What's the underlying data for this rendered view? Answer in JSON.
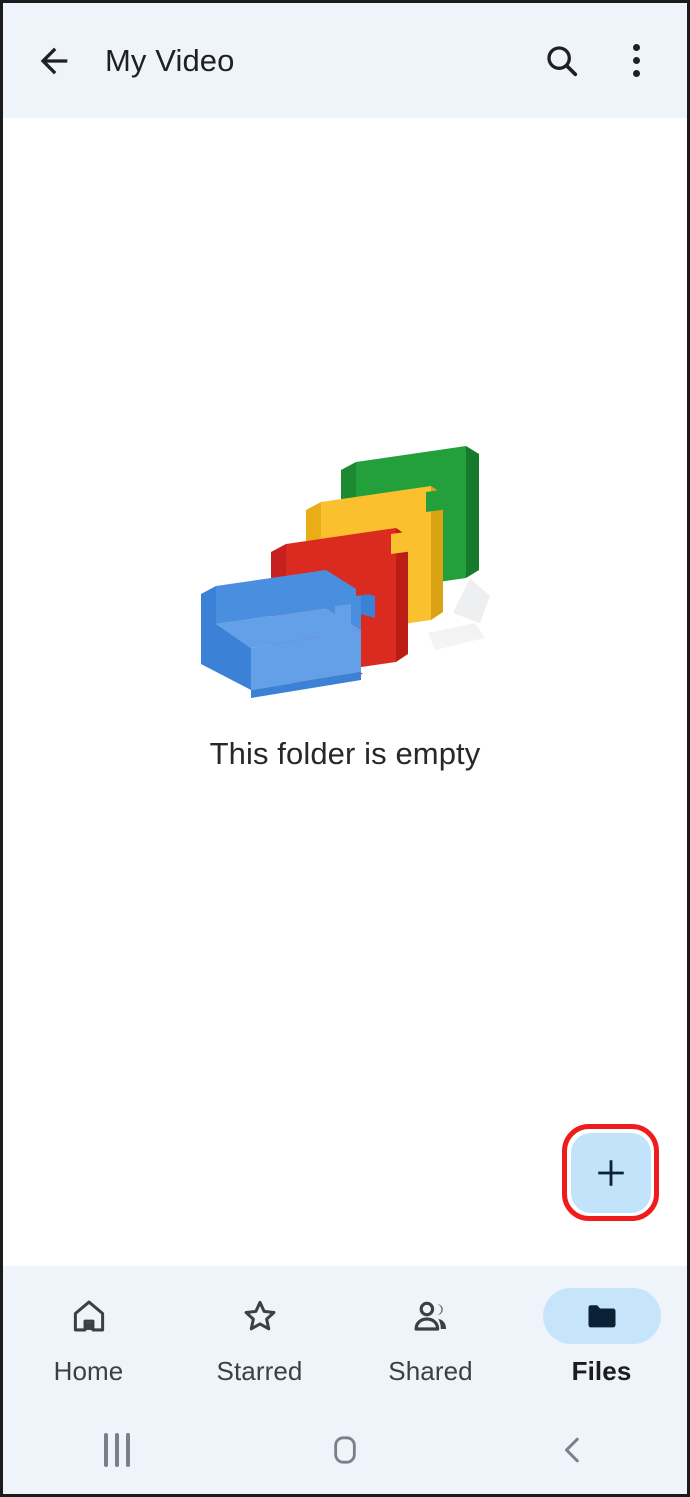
{
  "app_bar": {
    "back_icon": "arrow-left-icon",
    "title": "My Video",
    "search_icon": "search-icon",
    "overflow_icon": "more-vertical-icon"
  },
  "content": {
    "empty_state": {
      "illustration": "empty-folders-illustration",
      "message": "This folder is empty"
    },
    "fab": {
      "icon": "plus-icon",
      "label": "+",
      "highlight_color": "#ee1c1c",
      "background_color": "#c3e3fb"
    }
  },
  "bottom_nav": {
    "items": [
      {
        "label": "Home",
        "icon": "home-icon",
        "active": false
      },
      {
        "label": "Starred",
        "icon": "star-icon",
        "active": false
      },
      {
        "label": "Shared",
        "icon": "people-icon",
        "active": false
      },
      {
        "label": "Files",
        "icon": "folder-icon",
        "active": true
      }
    ],
    "active_pill_color": "#c6e5fb"
  },
  "system_nav": {
    "recents_icon": "recents-icon",
    "home_icon": "home-square-icon",
    "back_icon": "back-chevron-icon"
  },
  "colors": {
    "app_bar_background": "#eff3fa",
    "content_background": "#ffffff",
    "icon_dark": "#1f2023",
    "active_icon": "#0c2136",
    "folder_blue": "#3b82d6",
    "folder_blue_light": "#63a0e8",
    "folder_red": "#db2b20",
    "folder_red_dark": "#c62020",
    "folder_yellow": "#fbc02d",
    "folder_yellow_dark": "#e8ad17",
    "folder_green": "#23a03c",
    "folder_green_dark": "#1b8a33"
  }
}
